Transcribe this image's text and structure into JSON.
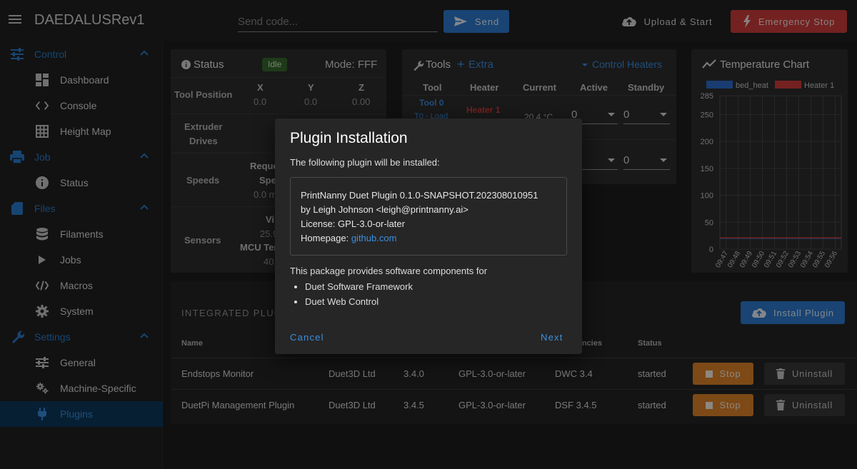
{
  "app": {
    "title": "DAEDALUSRev1"
  },
  "topbar": {
    "code_placeholder": "Send code...",
    "send_label": "Send",
    "upload_label": "Upload & Start",
    "estop_label": "Emergency Stop"
  },
  "sidebar": {
    "groups": [
      {
        "label": "Control",
        "icon": "tune-icon",
        "items": [
          {
            "label": "Dashboard",
            "icon": "dashboard-icon"
          },
          {
            "label": "Console",
            "icon": "code-icon"
          },
          {
            "label": "Height Map",
            "icon": "grid-icon"
          }
        ]
      },
      {
        "label": "Job",
        "icon": "printer-icon",
        "items": [
          {
            "label": "Status",
            "icon": "info-icon"
          }
        ]
      },
      {
        "label": "Files",
        "icon": "sd-card-icon",
        "items": [
          {
            "label": "Filaments",
            "icon": "database-icon"
          },
          {
            "label": "Jobs",
            "icon": "play-icon"
          },
          {
            "label": "Macros",
            "icon": "code-slash-icon"
          },
          {
            "label": "System",
            "icon": "cog-icon"
          }
        ]
      },
      {
        "label": "Settings",
        "icon": "wrench-icon",
        "items": [
          {
            "label": "General",
            "icon": "sliders-icon"
          },
          {
            "label": "Machine-Specific",
            "icon": "cogs-icon"
          },
          {
            "label": "Plugins",
            "icon": "plug-icon",
            "active": true
          }
        ]
      }
    ]
  },
  "status_card": {
    "title": "Status",
    "badge": "Idle",
    "mode": "Mode: FFF",
    "tool_position_label": "Tool Position",
    "axes": [
      "X",
      "Y",
      "Z"
    ],
    "positions": [
      "0.0",
      "0.0",
      "0.00"
    ],
    "extruder_label_1": "Extruder",
    "extruder_label_2": "Drives",
    "speeds_label": "Speeds",
    "speeds_req_1": "Reque",
    "speeds_req_2": "Spe",
    "speeds_val": "0.0 m",
    "sensors_label": "Sensors",
    "sensor_vin_label": "Vi",
    "sensor_vin_val": "25.9",
    "sensor_mcu_label": "MCU Ter",
    "sensor_mcu_val": "40"
  },
  "tools_card": {
    "title": "Tools",
    "extra_label": "Extra",
    "control_heaters_label": "Control Heaters",
    "columns": [
      "Tool",
      "Heater",
      "Current",
      "Active",
      "Standby"
    ],
    "tool_name": "Tool 0",
    "tool_sub": "T0 - Load",
    "heater_name": "Heater 1",
    "current_temp": "20.4 °C",
    "row1_active": "0",
    "row1_standby": "0",
    "row2_active": "0",
    "row2_standby": "0"
  },
  "chart_card": {
    "title": "Temperature Chart",
    "legend": [
      {
        "name": "bed_heat",
        "color": "#2e6fd0"
      },
      {
        "name": "Heater 1",
        "color": "#d43d3d"
      }
    ],
    "y_ticks": [
      "285",
      "250",
      "200",
      "150",
      "100",
      "50",
      "0"
    ],
    "x_ticks": [
      "09:47",
      "09:48",
      "09:49",
      "09:50",
      "09:51",
      "09:52",
      "09:53",
      "09:54",
      "09:55",
      "09:56"
    ]
  },
  "chart_data": {
    "type": "line",
    "title": "Temperature Chart",
    "xlabel": "",
    "ylabel": "",
    "ylim": [
      0,
      285
    ],
    "x": [
      "09:47",
      "09:48",
      "09:49",
      "09:50",
      "09:51",
      "09:52",
      "09:53",
      "09:54",
      "09:55",
      "09:56"
    ],
    "series": [
      {
        "name": "bed_heat",
        "values": [
          20,
          20,
          20,
          20,
          20,
          20,
          20,
          20,
          20,
          20
        ]
      },
      {
        "name": "Heater 1",
        "values": [
          21,
          21,
          21,
          21,
          21,
          21,
          21,
          21,
          21,
          21
        ]
      }
    ],
    "grid": true,
    "legend_position": "top"
  },
  "plugins_section": {
    "title": "INTEGRATED PLUGI",
    "install_label": "Install Plugin",
    "columns": [
      "Name",
      "dencies",
      "Status"
    ],
    "rows": [
      {
        "name": "Endstops Monitor",
        "author": "Duet3D Ltd",
        "version": "3.4.0",
        "license": "GPL-3.0-or-later",
        "dependencies": "DWC 3.4",
        "status": "started",
        "stop_label": "Stop",
        "uninstall_label": "Uninstall"
      },
      {
        "name": "DuetPi Management Plugin",
        "author": "Duet3D Ltd",
        "version": "3.4.5",
        "license": "GPL-3.0-or-later",
        "dependencies": "DSF 3.4.5",
        "status": "started",
        "stop_label": "Stop",
        "uninstall_label": "Uninstall"
      }
    ]
  },
  "dialog": {
    "title": "Plugin Installation",
    "subtitle": "The following plugin will be installed:",
    "plugin_line": "PrintNanny Duet Plugin 0.1.0-SNAPSHOT.202308010951",
    "author_line": "by Leigh Johnson <leigh@printnanny.ai>",
    "license_line": "License: GPL-3.0-or-later",
    "homepage_label": "Homepage: ",
    "homepage_link": "github.com",
    "description": "This package provides software components for",
    "components": [
      "Duet Software Framework",
      "Duet Web Control"
    ],
    "cancel_label": "Cancel",
    "next_label": "Next"
  },
  "colors": {
    "accent": "#2f7dd1",
    "danger": "#d23c3c",
    "warning": "#e2862a",
    "idle_badge": "#3a6b30"
  }
}
